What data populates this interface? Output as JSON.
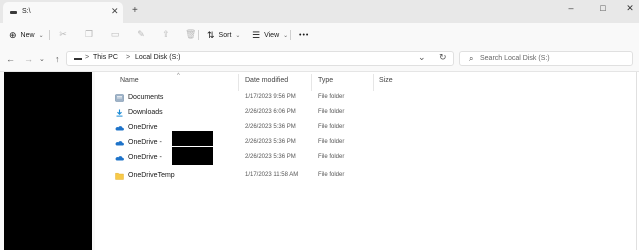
{
  "tab": {
    "title": "S:\\",
    "close": "✕"
  },
  "new_tab_label": "+",
  "window_controls": {
    "minimize": "–",
    "maximize": "□",
    "close": "✕"
  },
  "toolbar": {
    "new_label": "New",
    "sort_label": "Sort",
    "view_label": "View",
    "more_label": "•••"
  },
  "address": {
    "crumbs": [
      "This PC",
      "Local Disk (S:)"
    ],
    "separator": ">",
    "dropdown": "⌄",
    "refresh": "↻"
  },
  "search": {
    "placeholder": "Search Local Disk (S:)"
  },
  "columns": [
    "Name",
    "Date modified",
    "Type",
    "Size"
  ],
  "files": [
    {
      "name": "Documents",
      "date": "1/17/2023 9:56 PM",
      "type": "File folder",
      "icon": "documents-icon"
    },
    {
      "name": "Downloads",
      "date": "2/26/2023 6:06 PM",
      "type": "File folder",
      "icon": "downloads-icon"
    },
    {
      "name": "OneDrive",
      "date": "2/26/2023 5:36 PM",
      "type": "File folder",
      "icon": "onedrive-icon"
    },
    {
      "name": "OneDrive -",
      "date": "2/26/2023 5:36 PM",
      "type": "File folder",
      "icon": "onedrive-icon"
    },
    {
      "name": "OneDrive -",
      "date": "2/26/2023 5:36 PM",
      "type": "File folder",
      "icon": "onedrive-icon"
    },
    {
      "name": "OneDriveTemp",
      "date": "1/17/2023 11:58 AM",
      "type": "File folder",
      "icon": "folder-icon"
    }
  ],
  "colors": {
    "folder": "#f7c948",
    "onedrive": "#1e73c9",
    "download": "#1a8ad4"
  }
}
